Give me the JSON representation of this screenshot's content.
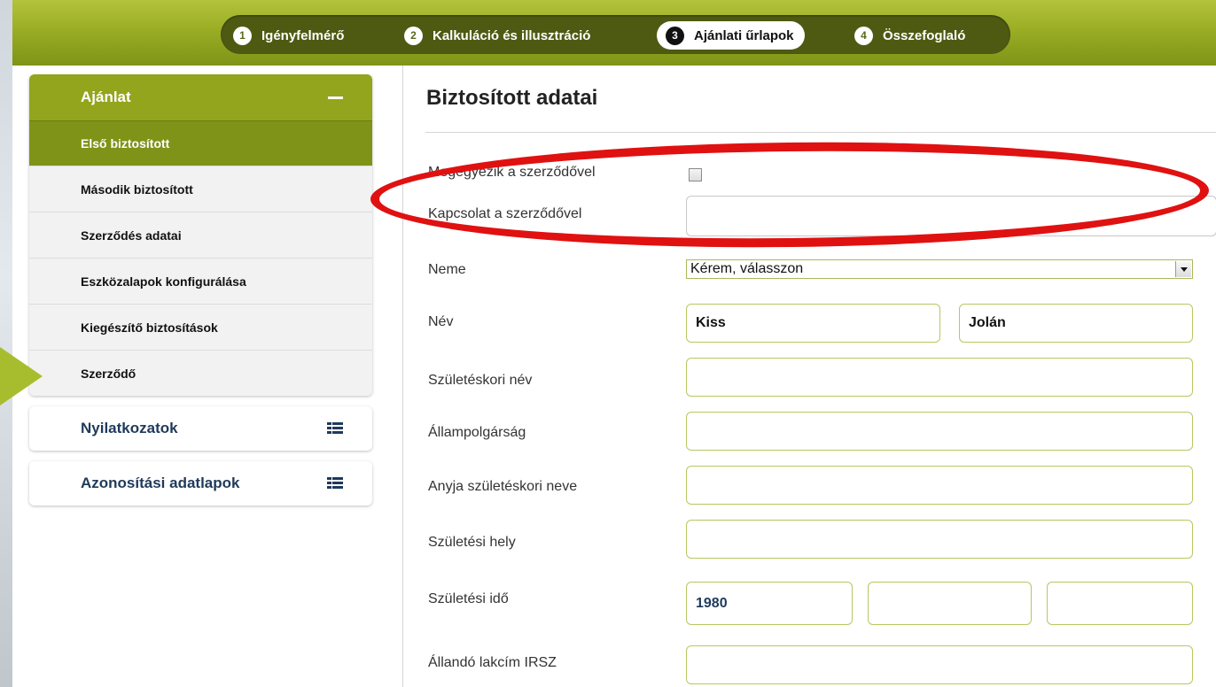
{
  "steps": [
    {
      "num": "1",
      "label": "Igényfelmérő"
    },
    {
      "num": "2",
      "label": "Kalkuláció és illusztráció"
    },
    {
      "num": "3",
      "label": "Ajánlati űrlapok"
    },
    {
      "num": "4",
      "label": "Összefoglaló"
    }
  ],
  "active_step": 3,
  "sidebar": {
    "ajanlat": {
      "title": "Ajánlat",
      "items": [
        "Első biztosított",
        "Második biztosított",
        "Szerződés adatai",
        "Eszközalapok konfigurálása",
        "Kiegészítő biztosítások",
        "Szerződő"
      ]
    },
    "nyilatkozatok": "Nyilatkozatok",
    "azonositasi": "Azonosítási adatlapok"
  },
  "form": {
    "title": "Biztosított adatai",
    "megegyezik_label": "Megegyezik a szerződővel",
    "kapcsolat_label": "Kapcsolat a szerződővel",
    "kapcsolat_value": "",
    "neme_label": "Neme",
    "neme_value": "Kérem, válasszon",
    "nev_label": "Név",
    "nev_last": "Kiss",
    "nev_first": "Jolán",
    "szuletesi_nev_label": "Születéskori név",
    "allampolgarsag_label": "Állampolgárság",
    "anyja_label": "Anyja születéskori neve",
    "szuletesi_hely_label": "Születési hely",
    "szuletesi_ido_label": "Születési idő",
    "szuletesi_ev": "1980",
    "szuletesi_ho": "",
    "szuletesi_nap": "",
    "irsz_label": "Állandó lakcím IRSZ"
  },
  "colors": {
    "brand_green": "#93a51c",
    "highlight_red": "#e01111"
  }
}
